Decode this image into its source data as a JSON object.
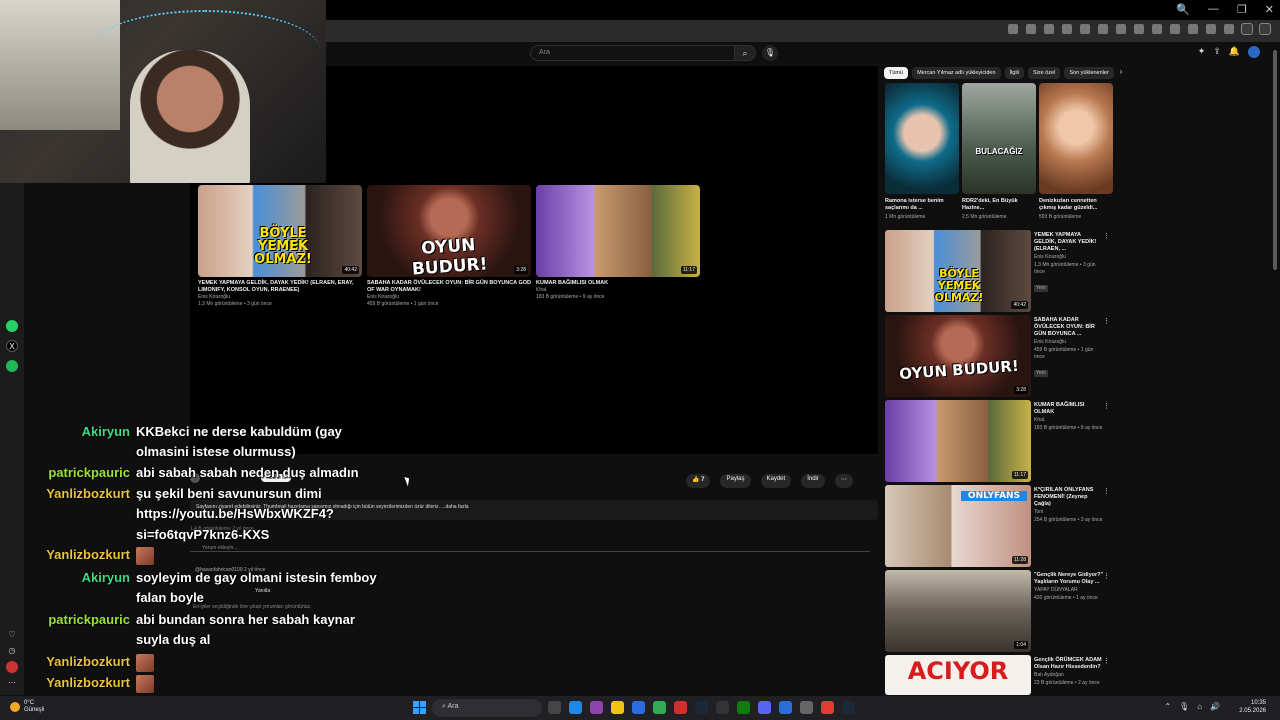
{
  "browser": {
    "window_controls": [
      "🔍",
      "—",
      "❐",
      "✕"
    ]
  },
  "youtube": {
    "search_placeholder": "Ara",
    "chips": [
      "Tümü",
      "Mercan Yılmaz adlı yükleyiciden",
      "İlgili",
      "Size özel",
      "Son yüklenenler"
    ],
    "action_buttons": [
      "7",
      "Paylaş",
      "Kaydet",
      "İndir"
    ],
    "description_text": "Sayfasını ziyaret edebilirsiniz. Thumbnail hazırlama şansımız olmadığı için bütün seyircilerimizden özür dileriz. ...daha fazla",
    "overlap_texts": {
      "channel_line": "1,4 B görüntüleme  2 yıl önce",
      "comment_placeholder": "Yorum ekleyin...",
      "comment_user": "@hasanfahrican0109  2 yıl önce",
      "top_comment_note": "En iyiler seçildiğinde öne çıkan yorumları görüntünüz.",
      "reply_label": "Yanıtla",
      "subscribe_label": "Abone ol",
      "subs": "Abone ol"
    }
  },
  "end_screen": [
    {
      "title": "YEMEK YAPMAYA GELDİK, DAYAK YEDİK! (ELRAEN, ERAY, LIMONIFY, KONSOL OYUN, RRAENEE)",
      "channel": "Enis Kirazoğlu",
      "meta": "1,3 Mn görüntüleme • 3 gün önce",
      "duration": "40:42",
      "overlay": "BÖYLE YEMEK OLMAZ!"
    },
    {
      "title": "SABAHA KADAR ÖVÜLECEK OYUN: BİR GÜN BOYUNCA GOD OF WAR OYNAMAK!",
      "channel": "Enis Kirazoğlu",
      "meta": "459 B görüntüleme • 1 gün önce",
      "duration": "3:28",
      "overlay": "OYUN BUDUR!"
    },
    {
      "title": "KUMAR BAĞIMLISI OLMAK",
      "channel": "Khal.",
      "meta": "183 B görüntüleme • 9 ay önce",
      "duration": "11:17",
      "overlay": ""
    }
  ],
  "shorts": [
    {
      "title": "Ramona isterse benim saçlarımı da ...",
      "meta": "1 Mn görüntüleme",
      "overlay": ""
    },
    {
      "title": "RDR2'deki, En Büyük Hazine...",
      "meta": "2,5 Mn görüntüleme",
      "overlay": "BULACAĞIZ"
    },
    {
      "title": "Denizkızları cennetten çıkmış kadar güzeldi...",
      "meta": "593 B görüntüleme",
      "overlay": ""
    }
  ],
  "recommendations": [
    {
      "title": "YEMEK YAPMAYA GELDİK, DAYAK YEDİK! (ELRAEN, ...",
      "channel": "Enis Kirazoğlu",
      "meta": "1,3 Mn görüntüleme • 3 gün önce",
      "badge": "Yeni",
      "duration": "40:42",
      "overlay": "BÖYLE YEMEK OLMAZ!"
    },
    {
      "title": "SABAHA KADAR ÖVÜLECEK OYUN: BİR GÜN BOYUNCA ...",
      "channel": "Enis Kirazoğlu",
      "meta": "459 B görüntüleme • 1 gün önce",
      "badge": "Yeni",
      "duration": "3:28",
      "overlay": "OYUN BUDUR!"
    },
    {
      "title": "KUMAR BAĞIMLISI OLMAK",
      "channel": "Khal.",
      "meta": "183 B görüntüleme • 9 ay önce",
      "badge": "",
      "duration": "11:17",
      "overlay": ""
    },
    {
      "title": "K*ÇIRILAN ONLYFANS FENOMENİ! (Zeynep Çağla)",
      "channel": "Toni",
      "meta": "254 B görüntüleme • 3 ay önce",
      "badge": "",
      "duration": "11:28",
      "overlay": "ONLYFANS"
    },
    {
      "title": "\"Gençlik Nereye Gidiyor?\" Yaşlıların Yorumu Olay ...",
      "channel": "YAPAY DÜNYALAR",
      "meta": "420 görüntüleme • 1 ay önce",
      "badge": "",
      "duration": "1:04",
      "overlay": ""
    },
    {
      "title": "Gençlik ÖRÜMCEK ADAM Olsan Hazır Hissederdin?",
      "channel": "Batı Aydoğan",
      "meta": "23 B görüntüleme • 2 ay önce",
      "badge": "",
      "duration": "",
      "overlay": "ACIYOR"
    }
  ],
  "chat": [
    {
      "user": "Akiryun",
      "user_color": "#3ddc84",
      "text": "KKBekci ne derse kabuldüm (gay"
    },
    {
      "user": "",
      "user_color": "",
      "text": "olmasini istese olurmuss)"
    },
    {
      "user": "patrickpauric",
      "user_color": "#9be236",
      "text": "abi sabah sabah neden duş almadın"
    },
    {
      "user": "Yanlizbozkurt",
      "user_color": "#e8c33c",
      "text": "şu şekil beni savunursun dimi"
    },
    {
      "user": "",
      "user_color": "",
      "text": "https://youtu.be/HsWbxWKZF4?"
    },
    {
      "user": "",
      "user_color": "",
      "text": "si=fo6tqvP7knz6-KXS"
    },
    {
      "user": "Yanlizbozkurt",
      "user_color": "#e8c33c",
      "text": ""
    },
    {
      "user": "Akiryun",
      "user_color": "#3ddc84",
      "text": "soyleyim de gay olmani istesin femboy"
    },
    {
      "user": "",
      "user_color": "",
      "text": "falan boyle"
    },
    {
      "user": "patrickpauric",
      "user_color": "#9be236",
      "text": "abi bundan sonra her sabah kaynar"
    },
    {
      "user": "",
      "user_color": "",
      "text": "suyla duş al"
    },
    {
      "user": "Yanlizbozkurt",
      "user_color": "#e8c33c",
      "text": ""
    },
    {
      "user": "Yanlizbozkurt",
      "user_color": "#e8c33c",
      "text": ""
    },
    {
      "user": "Yanlizbozkurt",
      "user_color": "#e8c33c",
      "text": ""
    }
  ],
  "taskbar": {
    "weather_temp": "0°C",
    "weather_desc": "Güneşli",
    "search_label": "Ara",
    "time": "10:35",
    "date": "2.05.2026"
  },
  "colors": {
    "yt_bg": "#0f0f0f",
    "accent_blue": "#3aa0ff"
  }
}
